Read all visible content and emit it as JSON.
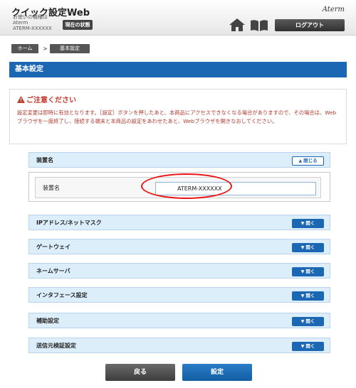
{
  "header": {
    "app_title": "クイック設定Web",
    "device_label": "お使いの機種は",
    "device_name": "Aterm",
    "device_id": "ATERM-XXXXXX",
    "status_button": "現在の状態",
    "brand": "Aterm",
    "logout_button": "ログアウト"
  },
  "breadcrumb": {
    "home": "ホーム",
    "separator": ">",
    "current": "基本設定"
  },
  "page_title": "基本設定",
  "caution": {
    "heading": "ご注意ください",
    "text": "設定変更は即時に有効となります。［設定］ボタンを押したあと、本商品にアクセスできなくなる場合がありますので、その場合は、Webブラウザを一度終了し、接続する端末と本商品の設定をあわせたあと、Webブラウザを開きなおしてください。"
  },
  "sections": {
    "device_name": {
      "label": "装置名",
      "toggle": "閉じる"
    },
    "ip": {
      "label": "IPアドレス/ネットマスク",
      "toggle": "開く"
    },
    "gateway": {
      "label": "ゲートウェイ",
      "toggle": "開く"
    },
    "nameserver": {
      "label": "ネームサーバ",
      "toggle": "開く"
    },
    "interface": {
      "label": "インタフェース設定",
      "toggle": "開く"
    },
    "aux": {
      "label": "補助設定",
      "toggle": "開く"
    },
    "source_verify": {
      "label": "送信元検証設定",
      "toggle": "開く"
    }
  },
  "device_field": {
    "label": "装置名",
    "value": "ATERM-XXXXXX"
  },
  "buttons": {
    "back": "戻る",
    "save": "設定"
  },
  "colors": {
    "primary": "#1b67b3",
    "section_bg": "#ddeefb",
    "caution": "#c0392b",
    "highlight": "#ee1111"
  }
}
